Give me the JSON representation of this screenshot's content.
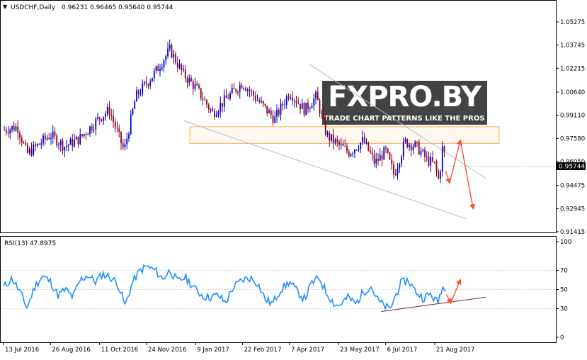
{
  "header": {
    "symbol_label": "USDCHF,Daily",
    "ohlc": "0.96231 0.96465 0.95640 0.95744"
  },
  "watermark": {
    "brand": "FXPRO.BY",
    "tagline": "TRADE CHART PATTERNS LIKE THE PROS"
  },
  "price_axis": {
    "ticks": [
      "1.05275",
      "1.03745",
      "1.02215",
      "1.00640",
      "0.99110",
      "0.97580",
      "0.96050",
      "0.94475",
      "0.92945",
      "0.91415"
    ],
    "current_label": "0.95744"
  },
  "rsi_panel": {
    "label": "RSI(13) 47.8975",
    "ticks": [
      "100",
      "70",
      "50",
      "30",
      "0"
    ]
  },
  "time_axis": {
    "ticks": [
      "13 Jul 2016",
      "26 Aug 2016",
      "11 Oct 2016",
      "24 Nov 2016",
      "9 Jan 2017",
      "22 Feb 2017",
      "7 Apr 2017",
      "23 May 2017",
      "6 Jul 2017",
      "21 Aug 2017"
    ]
  },
  "colors": {
    "bull": "#0000cc",
    "bear": "#8b0022",
    "rsi_line": "#1e90ff",
    "channel": "#a9bfd6",
    "zone": "#ffb060",
    "forecast_arrow": "#ff5030",
    "trendline": "#8b3a3a"
  },
  "chart_data": [
    {
      "type": "candlestick",
      "title": "USDCHF,Daily",
      "ylim": [
        0.91415,
        1.06
      ],
      "x_range": [
        "13 Jul 2016",
        "31 Aug 2017"
      ],
      "last_close": 0.95744,
      "ohlc_last": [
        0.96231,
        0.96465,
        0.9564,
        0.95744
      ],
      "trend_path": [
        {
          "date": "13 Jul 2016",
          "close": 0.9815
        },
        {
          "date": "26 Jul 2016",
          "close": 0.9835
        },
        {
          "date": "4 Aug 2016",
          "close": 0.9655
        },
        {
          "date": "26 Aug 2016",
          "close": 0.9782
        },
        {
          "date": "8 Sep 2016",
          "close": 0.9705
        },
        {
          "date": "22 Sep 2016",
          "close": 0.9755
        },
        {
          "date": "11 Oct 2016",
          "close": 0.9895
        },
        {
          "date": "20 Oct 2016",
          "close": 0.9945
        },
        {
          "date": "3 Nov 2016",
          "close": 0.9675
        },
        {
          "date": "14 Nov 2016",
          "close": 1.0035
        },
        {
          "date": "1 Dec 2016",
          "close": 1.0185
        },
        {
          "date": "16 Dec 2016",
          "close": 1.0345
        },
        {
          "date": "28 Dec 2016",
          "close": 1.0185
        },
        {
          "date": "9 Jan 2017",
          "close": 1.0095
        },
        {
          "date": "25 Jan 2017",
          "close": 0.9925
        },
        {
          "date": "10 Feb 2017",
          "close": 1.0045
        },
        {
          "date": "22 Feb 2017",
          "close": 1.0125
        },
        {
          "date": "10 Mar 2017",
          "close": 0.9995
        },
        {
          "date": "24 Mar 2017",
          "close": 0.9885
        },
        {
          "date": "7 Apr 2017",
          "close": 1.0065
        },
        {
          "date": "21 Apr 2017",
          "close": 0.9945
        },
        {
          "date": "2 May 2017",
          "close": 1.0035
        },
        {
          "date": "12 May 2017",
          "close": 0.9775
        },
        {
          "date": "23 May 2017",
          "close": 0.9715
        },
        {
          "date": "2 Jun 2017",
          "close": 0.9665
        },
        {
          "date": "15 Jun 2017",
          "close": 0.9745
        },
        {
          "date": "26 Jun 2017",
          "close": 0.9595
        },
        {
          "date": "6 Jul 2017",
          "close": 0.9675
        },
        {
          "date": "14 Jul 2017",
          "close": 0.9515
        },
        {
          "date": "24 Jul 2017",
          "close": 0.9735
        },
        {
          "date": "4 Aug 2017",
          "close": 0.9705
        },
        {
          "date": "14 Aug 2017",
          "close": 0.9615
        },
        {
          "date": "21 Aug 2017",
          "close": 0.9585
        },
        {
          "date": "25 Aug 2017",
          "close": 0.9475
        },
        {
          "date": "29 Aug 2017",
          "close": 0.9745
        },
        {
          "date": "31 Aug 2017",
          "close": 0.95744
        }
      ],
      "channel": {
        "upper": [
          {
            "date": "26 Apr 2017",
            "price": 1.0245
          },
          {
            "date": "8 Oct 2017",
            "price": 0.9495
          }
        ],
        "lower": [
          {
            "date": "29 Dec 2016",
            "price": 0.9875
          },
          {
            "date": "20 Sep 2017",
            "price": 0.9225
          }
        ]
      },
      "resistance_zone": [
        0.9725,
        0.9835
      ],
      "forecast_path": [
        {
          "date": "31 Aug 2017",
          "price": 0.9545
        },
        {
          "date": "4 Sep 2017",
          "price": 0.9465
        },
        {
          "date": "14 Sep 2017",
          "price": 0.9745
        },
        {
          "date": "26 Sep 2017",
          "price": 0.9295
        }
      ]
    },
    {
      "type": "line",
      "title": "RSI(13) 47.8975",
      "ylim": [
        0,
        100
      ],
      "levels": [
        30,
        50,
        70
      ],
      "last_value": 47.8975,
      "series": [
        {
          "date": "13 Jul 2016",
          "value": 52
        },
        {
          "date": "21 Jul 2016",
          "value": 62
        },
        {
          "date": "28 Jul 2016",
          "value": 48
        },
        {
          "date": "4 Aug 2016",
          "value": 31
        },
        {
          "date": "12 Aug 2016",
          "value": 55
        },
        {
          "date": "19 Aug 2016",
          "value": 64
        },
        {
          "date": "26 Aug 2016",
          "value": 58
        },
        {
          "date": "2 Sep 2016",
          "value": 44
        },
        {
          "date": "9 Sep 2016",
          "value": 50
        },
        {
          "date": "16 Sep 2016",
          "value": 42
        },
        {
          "date": "23 Sep 2016",
          "value": 60
        },
        {
          "date": "30 Sep 2016",
          "value": 65
        },
        {
          "date": "7 Oct 2016",
          "value": 58
        },
        {
          "date": "14 Oct 2016",
          "value": 66
        },
        {
          "date": "21 Oct 2016",
          "value": 63
        },
        {
          "date": "28 Oct 2016",
          "value": 56
        },
        {
          "date": "4 Nov 2016",
          "value": 33
        },
        {
          "date": "11 Nov 2016",
          "value": 58
        },
        {
          "date": "18 Nov 2016",
          "value": 70
        },
        {
          "date": "24 Nov 2016",
          "value": 74
        },
        {
          "date": "2 Dec 2016",
          "value": 70
        },
        {
          "date": "9 Dec 2016",
          "value": 61
        },
        {
          "date": "16 Dec 2016",
          "value": 70
        },
        {
          "date": "23 Dec 2016",
          "value": 58
        },
        {
          "date": "30 Dec 2016",
          "value": 63
        },
        {
          "date": "9 Jan 2017",
          "value": 50
        },
        {
          "date": "16 Jan 2017",
          "value": 43
        },
        {
          "date": "23 Jan 2017",
          "value": 42
        },
        {
          "date": "30 Jan 2017",
          "value": 44
        },
        {
          "date": "6 Feb 2017",
          "value": 36
        },
        {
          "date": "13 Feb 2017",
          "value": 52
        },
        {
          "date": "22 Feb 2017",
          "value": 60
        },
        {
          "date": "1 Mar 2017",
          "value": 62
        },
        {
          "date": "8 Mar 2017",
          "value": 57
        },
        {
          "date": "15 Mar 2017",
          "value": 40
        },
        {
          "date": "22 Mar 2017",
          "value": 35
        },
        {
          "date": "29 Mar 2017",
          "value": 49
        },
        {
          "date": "7 Apr 2017",
          "value": 58
        },
        {
          "date": "14 Apr 2017",
          "value": 48
        },
        {
          "date": "21 Apr 2017",
          "value": 40
        },
        {
          "date": "28 Apr 2017",
          "value": 57
        },
        {
          "date": "5 May 2017",
          "value": 62
        },
        {
          "date": "12 May 2017",
          "value": 46
        },
        {
          "date": "19 May 2017",
          "value": 35
        },
        {
          "date": "23 May 2017",
          "value": 33
        },
        {
          "date": "1 Jun 2017",
          "value": 42
        },
        {
          "date": "8 Jun 2017",
          "value": 35
        },
        {
          "date": "15 Jun 2017",
          "value": 47
        },
        {
          "date": "22 Jun 2017",
          "value": 54
        },
        {
          "date": "29 Jun 2017",
          "value": 38
        },
        {
          "date": "6 Jul 2017",
          "value": 32
        },
        {
          "date": "10 Jul 2017",
          "value": 29
        },
        {
          "date": "14 Jul 2017",
          "value": 40
        },
        {
          "date": "20 Jul 2017",
          "value": 56
        },
        {
          "date": "27 Jul 2017",
          "value": 60
        },
        {
          "date": "3 Aug 2017",
          "value": 48
        },
        {
          "date": "10 Aug 2017",
          "value": 41
        },
        {
          "date": "17 Aug 2017",
          "value": 45
        },
        {
          "date": "24 Aug 2017",
          "value": 36
        },
        {
          "date": "28 Aug 2017",
          "value": 54
        },
        {
          "date": "31 Aug 2017",
          "value": 47.9
        }
      ],
      "trendline": [
        {
          "date": "2 Jul 2017",
          "value": 27
        },
        {
          "date": "8 Oct 2017",
          "value": 42
        }
      ],
      "forecast_path": [
        {
          "date": "1 Sep 2017",
          "value": 45
        },
        {
          "date": "5 Sep 2017",
          "value": 36
        },
        {
          "date": "14 Sep 2017",
          "value": 60
        }
      ]
    }
  ]
}
